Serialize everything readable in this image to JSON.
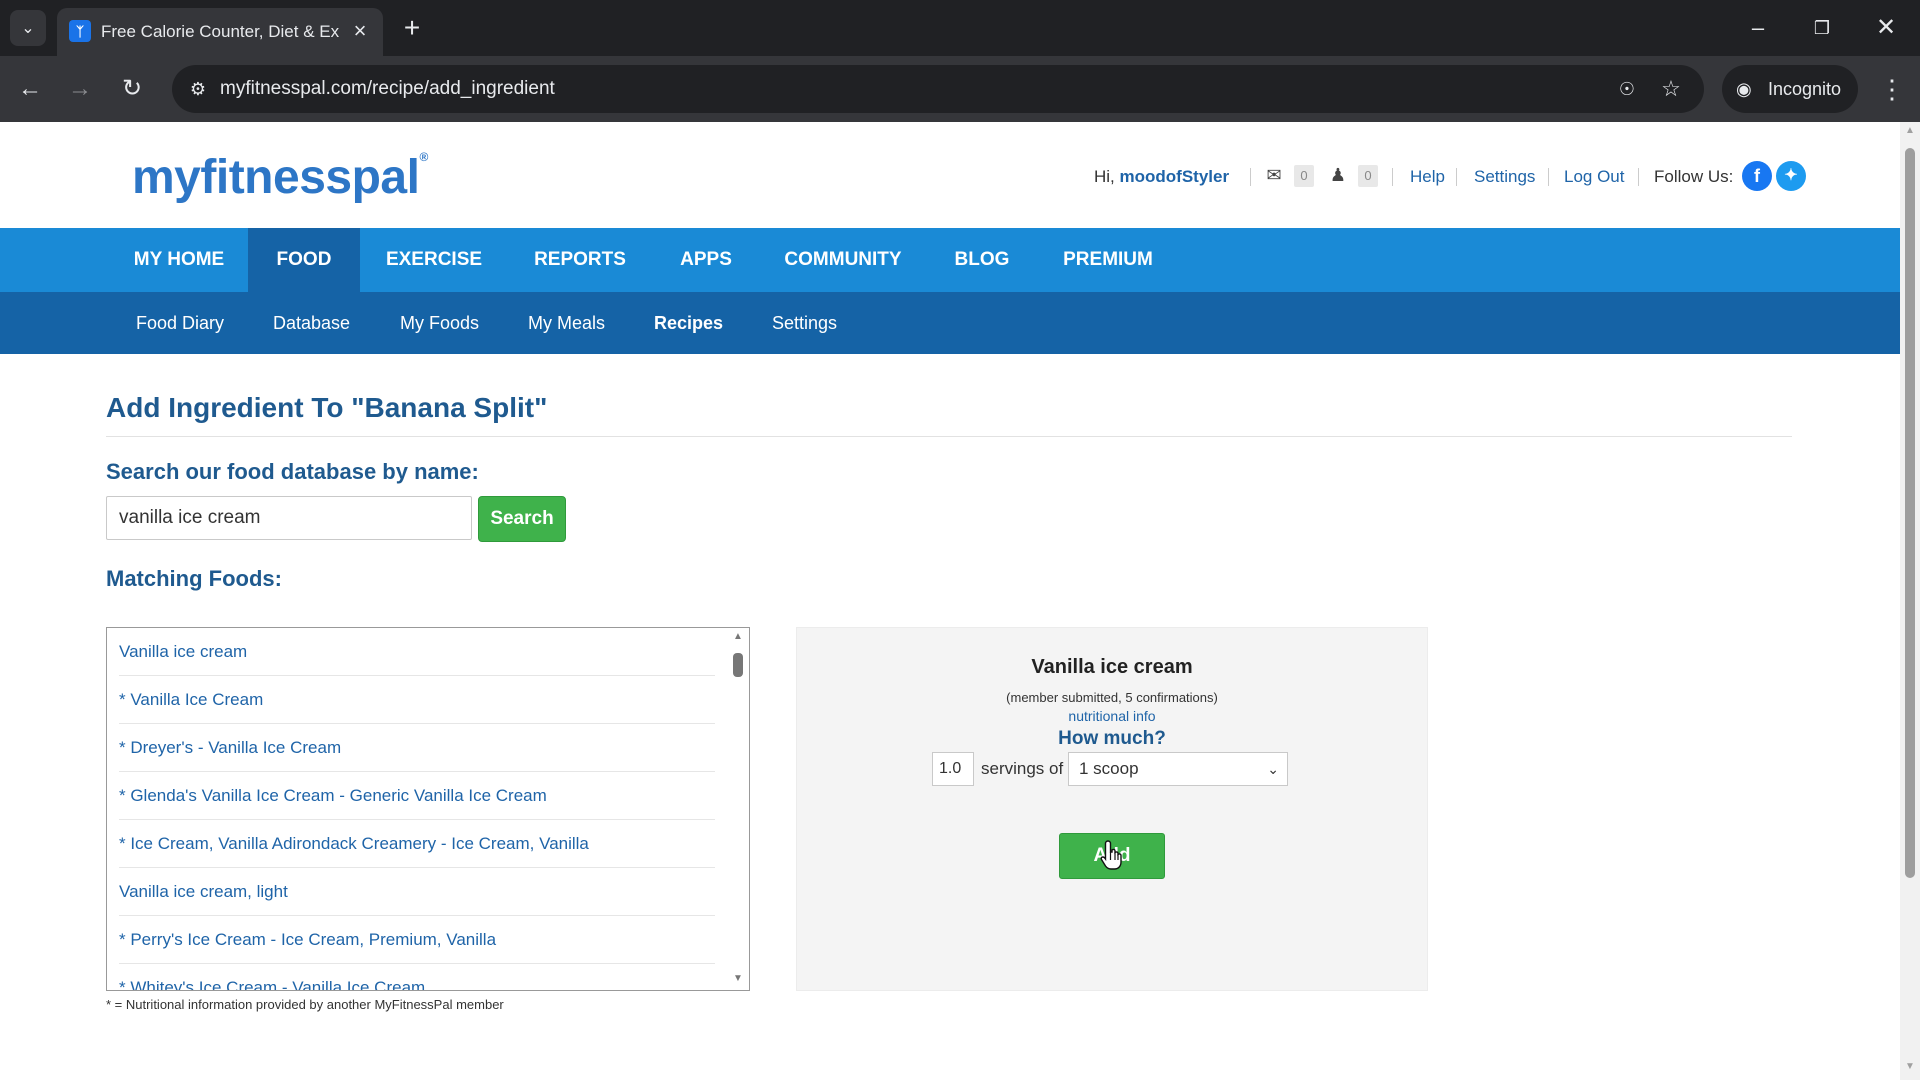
{
  "browser": {
    "tab_title": "Free Calorie Counter, Diet & Ex",
    "url": "myfitnesspal.com/recipe/add_ingredient",
    "incognito_label": "Incognito"
  },
  "header": {
    "logo": "myfitnesspal",
    "greeting_prefix": "Hi,",
    "username": "moodofStyler",
    "messages_count": "0",
    "friends_count": "0",
    "links": {
      "help": "Help",
      "settings": "Settings",
      "logout": "Log Out"
    },
    "follow_label": "Follow Us:"
  },
  "main_nav": [
    "MY HOME",
    "FOOD",
    "EXERCISE",
    "REPORTS",
    "APPS",
    "COMMUNITY",
    "BLOG",
    "PREMIUM"
  ],
  "main_nav_active": "FOOD",
  "sub_nav": [
    "Food Diary",
    "Database",
    "My Foods",
    "My Meals",
    "Recipes",
    "Settings"
  ],
  "sub_nav_active": "Recipes",
  "page": {
    "title": "Add Ingredient To \"Banana Split\"",
    "search_label": "Search our food database by name:",
    "search_value": "vanilla ice cream",
    "search_button": "Search",
    "matching_label": "Matching Foods:",
    "footnote": "* = Nutritional information provided by another MyFitnessPal member"
  },
  "results": [
    "Vanilla ice cream",
    "* Vanilla Ice Cream",
    "* Dreyer's - Vanilla Ice Cream",
    "* Glenda's Vanilla Ice Cream - Generic Vanilla Ice Cream",
    "* Ice Cream, Vanilla Adirondack Creamery - Ice Cream, Vanilla",
    "Vanilla ice cream, light",
    "* Perry's Ice Cream - Ice Cream, Premium, Vanilla",
    "* Whitey's Ice Cream - Vanilla Ice Cream"
  ],
  "detail": {
    "name": "Vanilla ice cream",
    "meta": "(member submitted, 5 confirmations)",
    "nutritional_info": "nutritional info",
    "how_much": "How much?",
    "servings_value": "1.0",
    "servings_of": "servings of",
    "serving_size": "1 scoop",
    "add_button": "Add"
  }
}
